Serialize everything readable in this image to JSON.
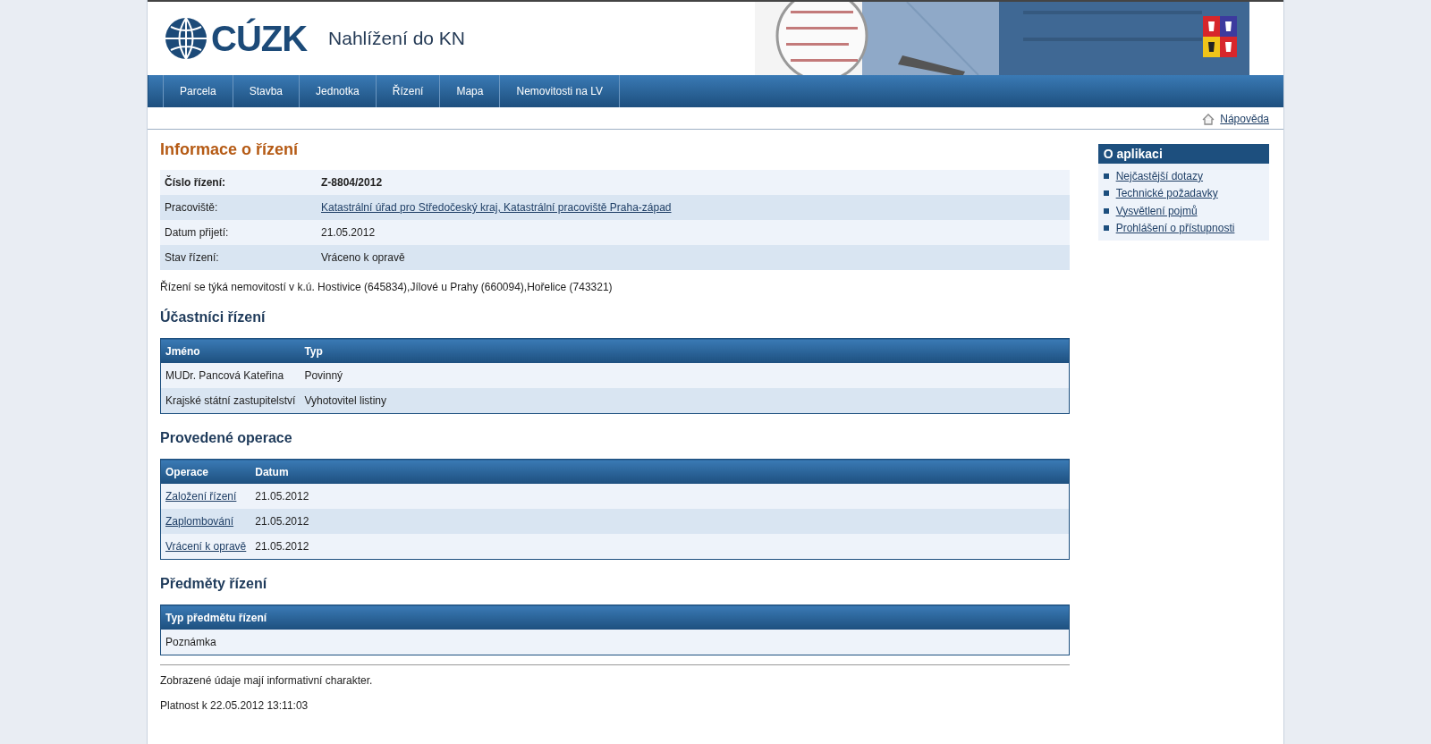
{
  "header": {
    "logo": "CÚZK",
    "title": "Nahlížení do KN"
  },
  "nav": [
    {
      "label": "Parcela"
    },
    {
      "label": "Stavba"
    },
    {
      "label": "Jednotka"
    },
    {
      "label": "Řízení"
    },
    {
      "label": "Mapa"
    },
    {
      "label": "Nemovitosti na LV"
    }
  ],
  "help_link": "Nápověda",
  "page_title": "Informace o řízení",
  "info": [
    {
      "label": "Číslo řízení:",
      "value": "Z-8804/2012",
      "bold": true,
      "link": false
    },
    {
      "label": "Pracoviště:",
      "value": "Katastrální úřad pro Středočeský kraj, Katastrální pracoviště Praha-západ",
      "bold": false,
      "link": true
    },
    {
      "label": "Datum přijetí:",
      "value": "21.05.2012",
      "bold": false,
      "link": false
    },
    {
      "label": "Stav řízení:",
      "value": "Vráceno k opravě",
      "bold": false,
      "link": false
    }
  ],
  "note": "Řízení se týká nemovitostí v k.ú. Hostivice (645834),Jílové u Prahy (660094),Hořelice (743321)",
  "sections": [
    {
      "title": "Účastníci řízení",
      "columns": [
        "Jméno",
        "Typ"
      ],
      "rows": [
        {
          "cells": [
            "MUDr. Pancová Kateřina",
            "Povinný"
          ],
          "link": false
        },
        {
          "cells": [
            "Krajské státní zastupitelství",
            "Vyhotovitel listiny"
          ],
          "link": false
        }
      ]
    },
    {
      "title": "Provedené operace",
      "columns": [
        "Operace",
        "Datum"
      ],
      "rows": [
        {
          "cells": [
            "Založení řízení",
            "21.05.2012"
          ],
          "link": true
        },
        {
          "cells": [
            "Zaplombování",
            "21.05.2012"
          ],
          "link": true
        },
        {
          "cells": [
            "Vrácení k opravě",
            "21.05.2012"
          ],
          "link": true
        }
      ]
    },
    {
      "title": "Předměty řízení",
      "columns": [
        "Typ předmětu řízení"
      ],
      "rows": [
        {
          "cells": [
            "Poznámka"
          ],
          "link": false
        }
      ]
    }
  ],
  "footer": [
    "Zobrazené údaje mají informativní charakter.",
    "Platnost k 22.05.2012 13:11:03"
  ],
  "sidebar": {
    "title": "O aplikaci",
    "links": [
      "Nejčastější dotazy",
      "Technické požadavky",
      "Vysvětlení pojmů",
      "Prohlášení o přístupnosti"
    ]
  }
}
